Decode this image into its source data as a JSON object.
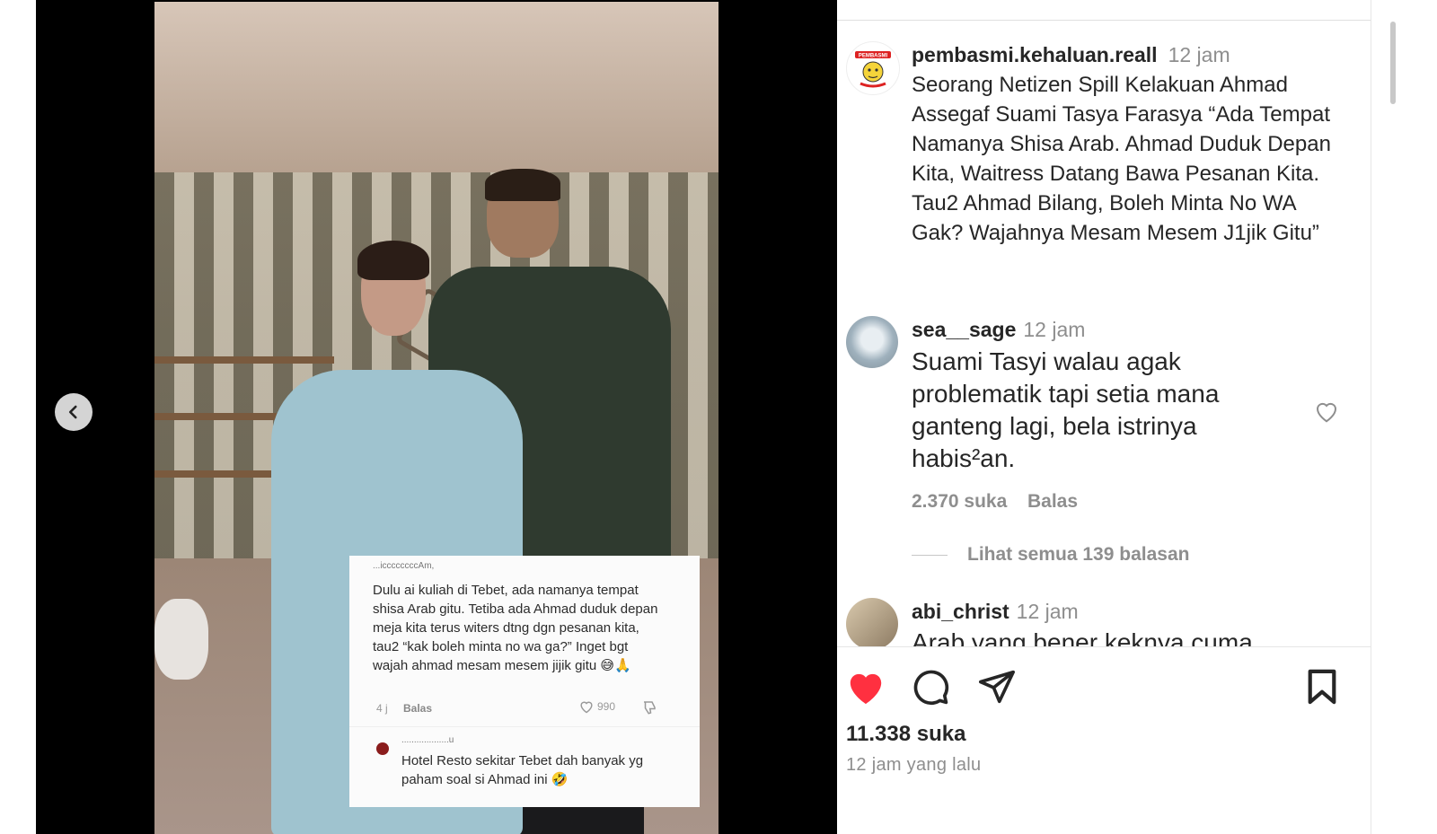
{
  "media": {
    "overlay_comment": {
      "username": "...iccccccccAm,",
      "text": "Dulu ai kuliah di Tebet, ada namanya tempat shisa Arab gitu. Tetiba ada Ahmad duduk depan meja kita terus witers dtng dgn pesanan kita, tau2 “kak boleh minta no wa ga?” Inget bgt wajah ahmad mesam mesem jijik gitu 😅🙏",
      "time": "4 j",
      "reply_label": "Balas",
      "like_count": "990"
    },
    "overlay_reply": {
      "username": "...................u",
      "text": "Hotel Resto sekitar Tebet dah banyak yg paham soal si Ahmad ini 🤣"
    }
  },
  "post": {
    "username": "pembasmi.kehaluan.reall",
    "time": "12 jam",
    "caption": "Seorang Netizen Spill Kelakuan  Ahmad Assegaf Suami Tasya Farasya “Ada Tempat Namanya Shisa Arab. Ahmad Duduk Depan Kita, Waitress Datang Bawa Pesanan Kita. Tau2 Ahmad Bilang, Boleh Minta No WA Gak?  Wajahnya Mesam Mesem J1jik Gitu”",
    "avatar_logo_text": "PEMBASMI"
  },
  "comments": [
    {
      "username": "sea__sage",
      "time": "12 jam",
      "text": "Suami Tasyi walau agak problematik tapi setia mana ganteng lagi, bela istrinya habis²an.",
      "likes": "2.370 suka",
      "reply_label": "Balas",
      "view_replies": "Lihat semua 139 balasan"
    },
    {
      "username": "abi_christ",
      "time": "12 jam",
      "text": "Arab yang bener keknya cuma"
    }
  ],
  "actions": {
    "likes": "11.338 suka",
    "posted": "12 jam yang lalu",
    "liked": true,
    "like_color": "#ff3040"
  }
}
